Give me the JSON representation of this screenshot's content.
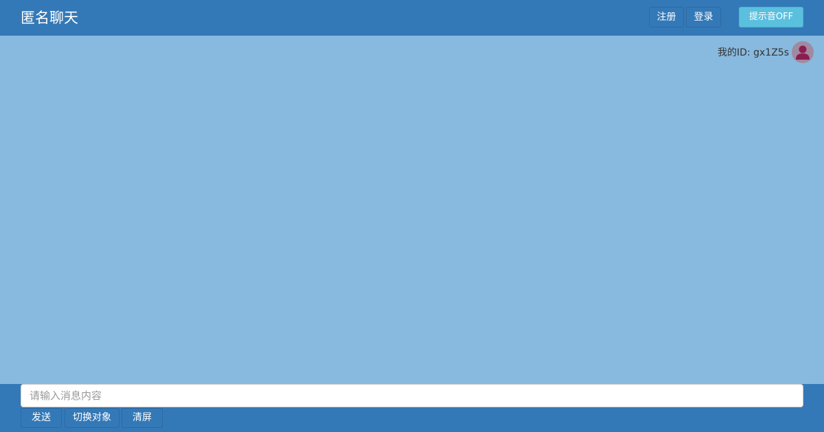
{
  "header": {
    "title": "匿名聊天",
    "buttons": [
      "注册",
      "登录"
    ],
    "toggle_label": "提示音OFF"
  },
  "user": {
    "id_label": "我的ID: gx1Z5s",
    "avatar_icon": "user-icon"
  },
  "composer": {
    "placeholder": "请输入消息内容",
    "actions": [
      "发送",
      "切换对象",
      "清屏"
    ]
  },
  "colors": {
    "header_bg": "#3479b7",
    "chat_bg": "#88b9df",
    "toggle_bg": "#5bc0de",
    "avatar_bg": "#a18a9f",
    "avatar_figure": "#8b1d52"
  }
}
